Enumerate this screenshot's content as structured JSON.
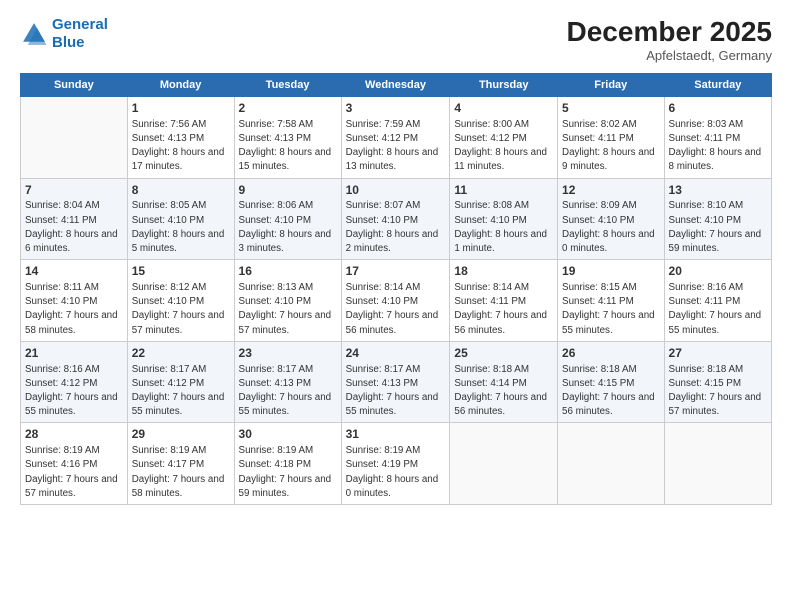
{
  "header": {
    "logo_line1": "General",
    "logo_line2": "Blue",
    "month_year": "December 2025",
    "location": "Apfelstaedt, Germany"
  },
  "days_of_week": [
    "Sunday",
    "Monday",
    "Tuesday",
    "Wednesday",
    "Thursday",
    "Friday",
    "Saturday"
  ],
  "weeks": [
    [
      {
        "day": "",
        "sunrise": "",
        "sunset": "",
        "daylight": ""
      },
      {
        "day": "1",
        "sunrise": "Sunrise: 7:56 AM",
        "sunset": "Sunset: 4:13 PM",
        "daylight": "Daylight: 8 hours and 17 minutes."
      },
      {
        "day": "2",
        "sunrise": "Sunrise: 7:58 AM",
        "sunset": "Sunset: 4:13 PM",
        "daylight": "Daylight: 8 hours and 15 minutes."
      },
      {
        "day": "3",
        "sunrise": "Sunrise: 7:59 AM",
        "sunset": "Sunset: 4:12 PM",
        "daylight": "Daylight: 8 hours and 13 minutes."
      },
      {
        "day": "4",
        "sunrise": "Sunrise: 8:00 AM",
        "sunset": "Sunset: 4:12 PM",
        "daylight": "Daylight: 8 hours and 11 minutes."
      },
      {
        "day": "5",
        "sunrise": "Sunrise: 8:02 AM",
        "sunset": "Sunset: 4:11 PM",
        "daylight": "Daylight: 8 hours and 9 minutes."
      },
      {
        "day": "6",
        "sunrise": "Sunrise: 8:03 AM",
        "sunset": "Sunset: 4:11 PM",
        "daylight": "Daylight: 8 hours and 8 minutes."
      }
    ],
    [
      {
        "day": "7",
        "sunrise": "Sunrise: 8:04 AM",
        "sunset": "Sunset: 4:11 PM",
        "daylight": "Daylight: 8 hours and 6 minutes."
      },
      {
        "day": "8",
        "sunrise": "Sunrise: 8:05 AM",
        "sunset": "Sunset: 4:10 PM",
        "daylight": "Daylight: 8 hours and 5 minutes."
      },
      {
        "day": "9",
        "sunrise": "Sunrise: 8:06 AM",
        "sunset": "Sunset: 4:10 PM",
        "daylight": "Daylight: 8 hours and 3 minutes."
      },
      {
        "day": "10",
        "sunrise": "Sunrise: 8:07 AM",
        "sunset": "Sunset: 4:10 PM",
        "daylight": "Daylight: 8 hours and 2 minutes."
      },
      {
        "day": "11",
        "sunrise": "Sunrise: 8:08 AM",
        "sunset": "Sunset: 4:10 PM",
        "daylight": "Daylight: 8 hours and 1 minute."
      },
      {
        "day": "12",
        "sunrise": "Sunrise: 8:09 AM",
        "sunset": "Sunset: 4:10 PM",
        "daylight": "Daylight: 8 hours and 0 minutes."
      },
      {
        "day": "13",
        "sunrise": "Sunrise: 8:10 AM",
        "sunset": "Sunset: 4:10 PM",
        "daylight": "Daylight: 7 hours and 59 minutes."
      }
    ],
    [
      {
        "day": "14",
        "sunrise": "Sunrise: 8:11 AM",
        "sunset": "Sunset: 4:10 PM",
        "daylight": "Daylight: 7 hours and 58 minutes."
      },
      {
        "day": "15",
        "sunrise": "Sunrise: 8:12 AM",
        "sunset": "Sunset: 4:10 PM",
        "daylight": "Daylight: 7 hours and 57 minutes."
      },
      {
        "day": "16",
        "sunrise": "Sunrise: 8:13 AM",
        "sunset": "Sunset: 4:10 PM",
        "daylight": "Daylight: 7 hours and 57 minutes."
      },
      {
        "day": "17",
        "sunrise": "Sunrise: 8:14 AM",
        "sunset": "Sunset: 4:10 PM",
        "daylight": "Daylight: 7 hours and 56 minutes."
      },
      {
        "day": "18",
        "sunrise": "Sunrise: 8:14 AM",
        "sunset": "Sunset: 4:11 PM",
        "daylight": "Daylight: 7 hours and 56 minutes."
      },
      {
        "day": "19",
        "sunrise": "Sunrise: 8:15 AM",
        "sunset": "Sunset: 4:11 PM",
        "daylight": "Daylight: 7 hours and 55 minutes."
      },
      {
        "day": "20",
        "sunrise": "Sunrise: 8:16 AM",
        "sunset": "Sunset: 4:11 PM",
        "daylight": "Daylight: 7 hours and 55 minutes."
      }
    ],
    [
      {
        "day": "21",
        "sunrise": "Sunrise: 8:16 AM",
        "sunset": "Sunset: 4:12 PM",
        "daylight": "Daylight: 7 hours and 55 minutes."
      },
      {
        "day": "22",
        "sunrise": "Sunrise: 8:17 AM",
        "sunset": "Sunset: 4:12 PM",
        "daylight": "Daylight: 7 hours and 55 minutes."
      },
      {
        "day": "23",
        "sunrise": "Sunrise: 8:17 AM",
        "sunset": "Sunset: 4:13 PM",
        "daylight": "Daylight: 7 hours and 55 minutes."
      },
      {
        "day": "24",
        "sunrise": "Sunrise: 8:17 AM",
        "sunset": "Sunset: 4:13 PM",
        "daylight": "Daylight: 7 hours and 55 minutes."
      },
      {
        "day": "25",
        "sunrise": "Sunrise: 8:18 AM",
        "sunset": "Sunset: 4:14 PM",
        "daylight": "Daylight: 7 hours and 56 minutes."
      },
      {
        "day": "26",
        "sunrise": "Sunrise: 8:18 AM",
        "sunset": "Sunset: 4:15 PM",
        "daylight": "Daylight: 7 hours and 56 minutes."
      },
      {
        "day": "27",
        "sunrise": "Sunrise: 8:18 AM",
        "sunset": "Sunset: 4:15 PM",
        "daylight": "Daylight: 7 hours and 57 minutes."
      }
    ],
    [
      {
        "day": "28",
        "sunrise": "Sunrise: 8:19 AM",
        "sunset": "Sunset: 4:16 PM",
        "daylight": "Daylight: 7 hours and 57 minutes."
      },
      {
        "day": "29",
        "sunrise": "Sunrise: 8:19 AM",
        "sunset": "Sunset: 4:17 PM",
        "daylight": "Daylight: 7 hours and 58 minutes."
      },
      {
        "day": "30",
        "sunrise": "Sunrise: 8:19 AM",
        "sunset": "Sunset: 4:18 PM",
        "daylight": "Daylight: 7 hours and 59 minutes."
      },
      {
        "day": "31",
        "sunrise": "Sunrise: 8:19 AM",
        "sunset": "Sunset: 4:19 PM",
        "daylight": "Daylight: 8 hours and 0 minutes."
      },
      {
        "day": "",
        "sunrise": "",
        "sunset": "",
        "daylight": ""
      },
      {
        "day": "",
        "sunrise": "",
        "sunset": "",
        "daylight": ""
      },
      {
        "day": "",
        "sunrise": "",
        "sunset": "",
        "daylight": ""
      }
    ]
  ]
}
